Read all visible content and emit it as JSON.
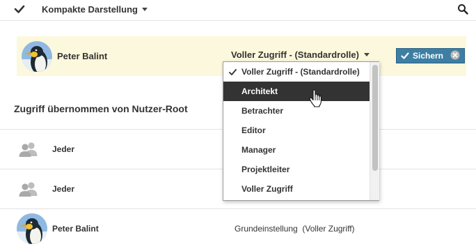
{
  "toolbar": {
    "select_icon": "checkmark-icon",
    "view_label": "Kompakte Darstellung",
    "search_icon": "search-icon"
  },
  "edit_row": {
    "name": "Peter Balint",
    "role": "Voller Zugriff - (Standardrolle)",
    "save_label": "Sichern",
    "highlight_color": "#fcf8dd",
    "save_color": "#3d7ea3"
  },
  "dropdown": {
    "selected": "Voller Zugriff - (Standardrolle)",
    "hovered": "Architekt",
    "options": [
      "Voller Zugriff - (Standardrolle)",
      "Architekt",
      "Betrachter",
      "Editor",
      "Manager",
      "Projektleiter",
      "Voller Zugriff"
    ]
  },
  "section": {
    "title": "Zugriff übernommen von Nutzer-Root"
  },
  "rows": [
    {
      "name": "Jeder",
      "icon": "group-icon",
      "role": ""
    },
    {
      "name": "Jeder",
      "icon": "group-icon",
      "role": ""
    },
    {
      "name": "Peter Balint",
      "icon": "penguin-avatar",
      "role": "Grundeinstellung  (Voller Zugriff)"
    }
  ]
}
